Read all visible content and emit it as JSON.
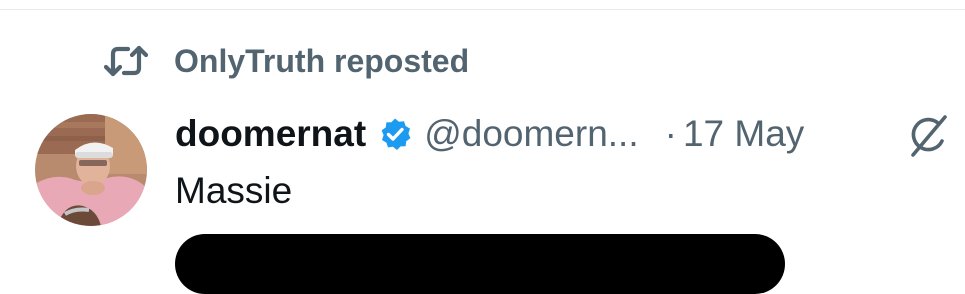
{
  "repost": {
    "label": "OnlyTruth reposted",
    "icon": "repost-icon"
  },
  "post": {
    "display_name": "doomernat",
    "verified": true,
    "verified_color": "#1d9bf0",
    "handle": "@doomern...",
    "separator": "·",
    "date": "17 May",
    "text": "Massie",
    "avatar_icon": "avatar",
    "grok_icon": "grok-icon"
  },
  "colors": {
    "secondary_text": "#536471",
    "primary_text": "#0f1419",
    "divider": "#e6eaed"
  }
}
